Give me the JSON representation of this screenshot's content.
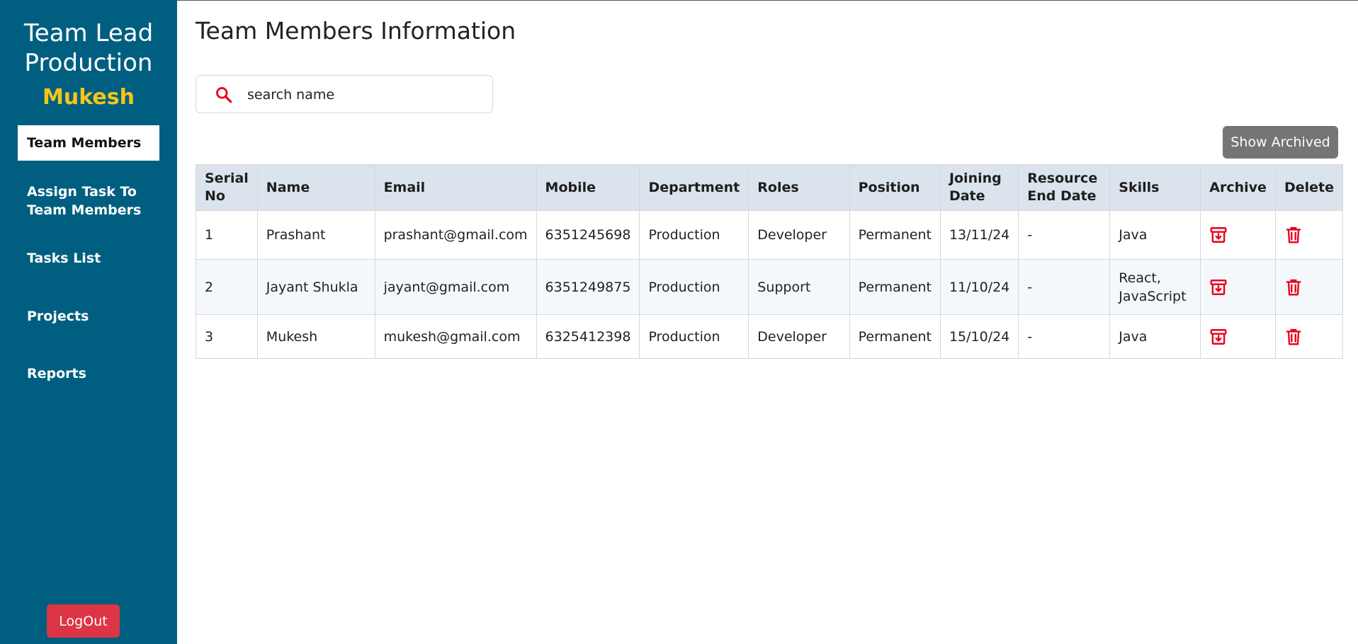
{
  "sidebar": {
    "title_line1": "Team Lead",
    "title_line2": "Production",
    "user": "Mukesh",
    "items": [
      {
        "label": "Team Members",
        "active": true
      },
      {
        "label": "Assign Task To Team Members"
      },
      {
        "label": "Tasks List"
      },
      {
        "label": "Projects"
      },
      {
        "label": "Reports"
      }
    ],
    "logout_label": "LogOut"
  },
  "main": {
    "title": "Team Members Information",
    "search": {
      "placeholder": "search name",
      "icon": "search-icon"
    },
    "show_archived_label": "Show Archived",
    "table": {
      "headers": [
        "Serial No",
        "Name",
        "Email",
        "Mobile",
        "Department",
        "Roles",
        "Position",
        "Joining Date",
        "Resource End Date",
        "Skills",
        "Archive",
        "Delete"
      ],
      "rows": [
        {
          "serial": "1",
          "name": "Prashant",
          "email": "prashant@gmail.com",
          "mobile": "6351245698",
          "department": "Production",
          "role": "Developer",
          "position": "Permanent",
          "joining_date": "13/11/24",
          "end_date": "-",
          "skills": "Java"
        },
        {
          "serial": "2",
          "name": "Jayant Shukla",
          "email": "jayant@gmail.com",
          "mobile": "6351249875",
          "department": "Production",
          "role": "Support",
          "position": "Permanent",
          "joining_date": "11/10/24",
          "end_date": "-",
          "skills": "React, JavaScript"
        },
        {
          "serial": "3",
          "name": "Mukesh",
          "email": "mukesh@gmail.com",
          "mobile": "6325412398",
          "department": "Production",
          "role": "Developer",
          "position": "Permanent",
          "joining_date": "15/10/24",
          "end_date": "-",
          "skills": "Java"
        }
      ]
    }
  },
  "colors": {
    "sidebar_bg": "#005f80",
    "user_name": "#f5c518",
    "logout_bg": "#dc3545",
    "icon_red": "#e8001c",
    "archived_btn_bg": "#757575",
    "table_header_bg": "#dbe3ec"
  }
}
